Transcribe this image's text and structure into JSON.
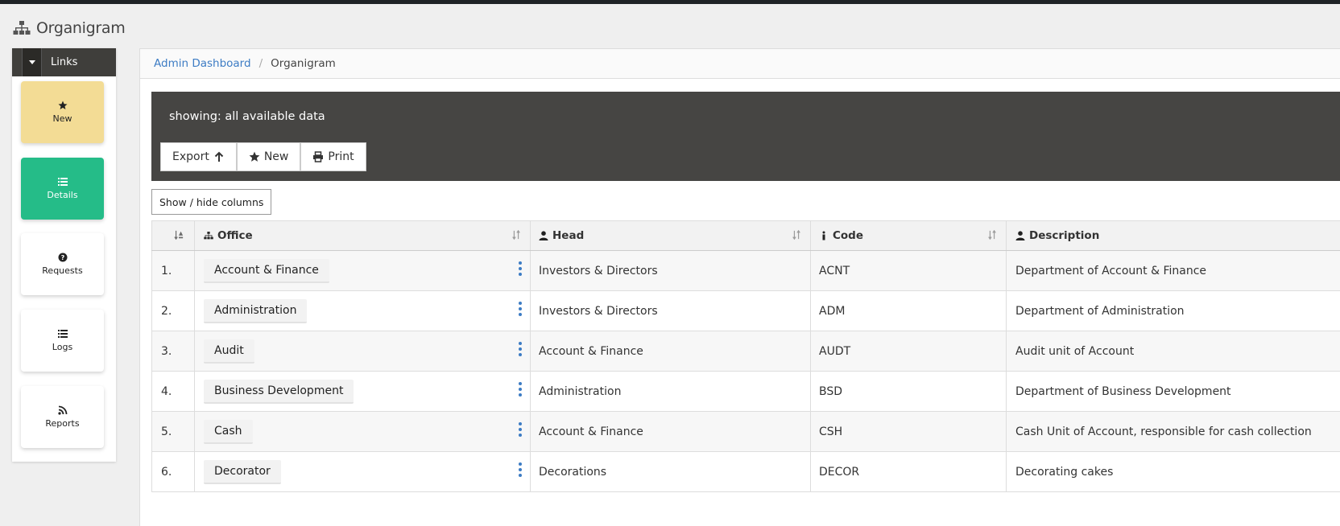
{
  "app": {
    "title": "Organigram"
  },
  "sidebar": {
    "links_label": "Links",
    "tiles": [
      {
        "label": "New",
        "icon": "star-icon"
      },
      {
        "label": "Details",
        "icon": "list-icon"
      },
      {
        "label": "Requests",
        "icon": "question-icon"
      },
      {
        "label": "Logs",
        "icon": "list-icon"
      },
      {
        "label": "Reports",
        "icon": "rss-icon"
      }
    ]
  },
  "breadcrumb": {
    "parent": "Admin Dashboard",
    "current": "Organigram"
  },
  "toolbar": {
    "showing_text": "showing: all available data",
    "export_label": "Export",
    "new_label": "New",
    "print_label": "Print",
    "show_hide_label": "Show / hide columns"
  },
  "table": {
    "headers": {
      "office": "Office",
      "head": "Head",
      "code": "Code",
      "description": "Description"
    },
    "rows": [
      {
        "num": "1.",
        "office": "Account & Finance",
        "head": "Investors & Directors",
        "code": "ACNT",
        "description": "Department of Account & Finance"
      },
      {
        "num": "2.",
        "office": "Administration",
        "head": "Investors & Directors",
        "code": "ADM",
        "description": "Department of Administration"
      },
      {
        "num": "3.",
        "office": "Audit",
        "head": "Account & Finance",
        "code": "AUDT",
        "description": "Audit unit of Account"
      },
      {
        "num": "4.",
        "office": "Business Development",
        "head": "Administration",
        "code": "BSD",
        "description": "Department of Business Development"
      },
      {
        "num": "5.",
        "office": "Cash",
        "head": "Account & Finance",
        "code": "CSH",
        "description": "Cash Unit of Account, responsible for cash collection"
      },
      {
        "num": "6.",
        "office": "Decorator",
        "head": "Decorations",
        "code": "DECOR",
        "description": "Decorating cakes"
      }
    ]
  },
  "colors": {
    "accent": "#3d7cc4",
    "details_tile": "#25bc88",
    "new_tile": "#f3dc95",
    "dark_panel": "#464543"
  }
}
